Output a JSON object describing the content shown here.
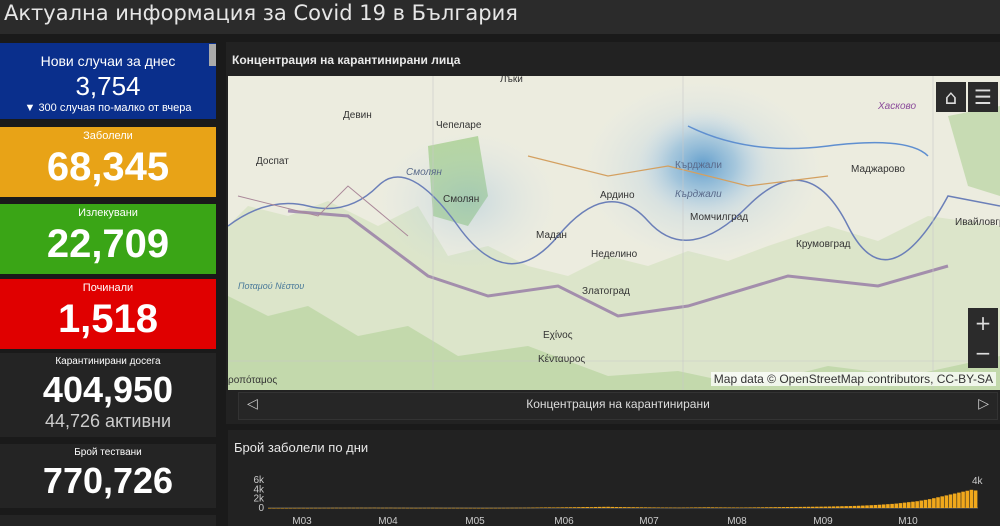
{
  "header": {
    "title": "Актуална информация за Covid 19 в България"
  },
  "cards": {
    "new": {
      "label": "Нови случаи за днес",
      "value": "3,754",
      "sub": "▼ 300 случая по-малко от вчера",
      "color": "#0a2f8c"
    },
    "infected": {
      "label": "Заболели",
      "value": "68,345",
      "color": "#e8a317"
    },
    "recovered": {
      "label": "Излекувани",
      "value": "22,709",
      "color": "#3aa516"
    },
    "deaths": {
      "label": "Починали",
      "value": "1,518",
      "color": "#e00000"
    },
    "quarantined": {
      "label": "Карантинирани досега",
      "value": "404,950",
      "sub": "44,726 активни",
      "color": "#1a1a1a"
    },
    "tests": {
      "label": "Брой тествани",
      "value": "770,726",
      "color": "#1a1a1a"
    }
  },
  "map_panel": {
    "title": "Концентрация на карантинирани лица",
    "attribution": "Map data © OpenStreetMap contributors, CC-BY-SA",
    "places": [
      "Хасково",
      "Девин",
      "Чепеларе",
      "Лъки",
      "Доспат",
      "Смолян",
      "Смолян",
      "Кърджали",
      "Кърджали",
      "Маджарово",
      "Ардино",
      "Момчилград",
      "Ивайловград",
      "Мадан",
      "Неделино",
      "Крумовград",
      "Златоград",
      "Ποταμού Νέστου",
      "Εχίνος",
      "Κένταυρος",
      "ροπόταμος"
    ],
    "home_icon": "home-icon",
    "list_icon": "list-icon",
    "zoom_in": "+",
    "zoom_out": "−",
    "carousel_label": "Концентрация на карантинирани"
  },
  "chart_panel": {
    "title": "Брой заболели по дни"
  },
  "chart_data": {
    "type": "bar",
    "title": "Брой заболели по дни",
    "y_ticks": [
      "6k",
      "4k",
      "2k",
      "0"
    ],
    "ylim": [
      0,
      6000
    ],
    "x_ticks": [
      "M03",
      "M04",
      "M05",
      "M06",
      "M07",
      "M08",
      "M09",
      "M10"
    ],
    "peak_label": "4k",
    "x_start": "2020-03-08",
    "values": [
      4,
      3,
      7,
      3,
      6,
      10,
      15,
      20,
      22,
      18,
      25,
      30,
      28,
      35,
      33,
      40,
      45,
      38,
      42,
      50,
      44,
      48,
      52,
      47,
      55,
      60,
      50,
      45,
      48,
      52,
      40,
      38,
      42,
      35,
      30,
      28,
      32,
      36,
      40,
      38,
      35,
      30,
      25,
      28,
      32,
      30,
      28,
      26,
      24,
      22,
      20,
      18,
      22,
      25,
      28,
      30,
      35,
      40,
      45,
      50,
      55,
      60,
      70,
      80,
      95,
      110,
      120,
      130,
      115,
      125,
      140,
      150,
      160,
      170,
      180,
      200,
      210,
      190,
      220,
      240,
      250,
      260,
      230,
      210,
      200,
      190,
      180,
      170,
      160,
      150,
      140,
      130,
      120,
      110,
      100,
      95,
      90,
      85,
      80,
      90,
      100,
      110,
      120,
      130,
      140,
      150,
      140,
      130,
      125,
      120,
      115,
      110,
      105,
      100,
      110,
      120,
      130,
      140,
      150,
      160,
      170,
      180,
      190,
      200,
      210,
      220,
      230,
      240,
      250,
      260,
      270,
      280,
      290,
      300,
      320,
      340,
      360,
      380,
      400,
      420,
      450,
      480,
      520,
      560,
      600,
      650,
      700,
      760,
      820,
      880,
      950,
      1050,
      1150,
      1250,
      1350,
      1450,
      1600,
      1750,
      1900,
      2100,
      2300,
      2500,
      2700,
      2900,
      3100,
      3300,
      3500,
      3700,
      3900,
      3754
    ]
  }
}
